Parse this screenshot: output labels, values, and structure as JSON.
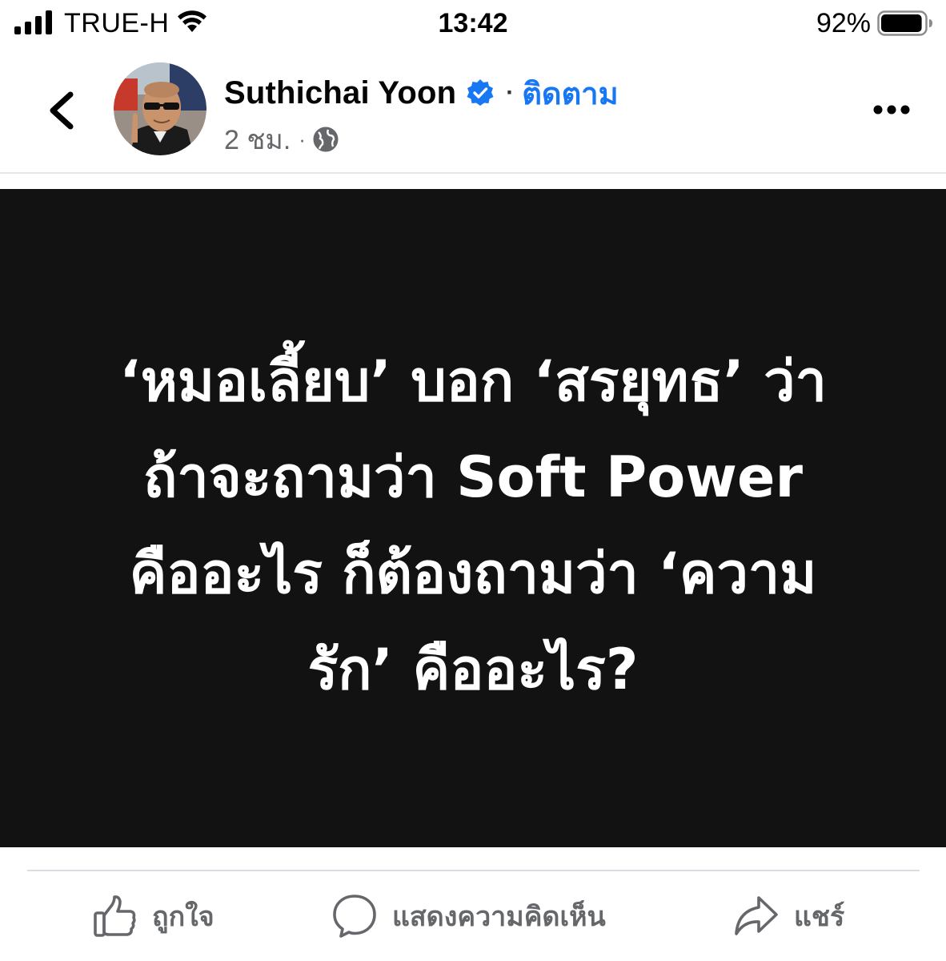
{
  "status_bar": {
    "carrier": "TRUE-H",
    "time": "13:42",
    "battery_percent": "92%",
    "battery_level": 0.92,
    "icons": [
      "signal-bars-icon",
      "wifi-icon",
      "battery-icon"
    ]
  },
  "post": {
    "author": "Suthichai Yoon",
    "verified": true,
    "separator": "·",
    "follow_label": "ติดตาม",
    "timestamp": "2 ชม.",
    "meta_separator": "·",
    "audience_icon": "globe-icon",
    "header_icons": [
      "back-chevron-icon",
      "more-options-icon",
      "verified-badge-icon"
    ]
  },
  "image": {
    "lines": [
      "‘หมอเลี้ยบ’ บอก ‘สรยุทธ’ ว่า",
      "ถ้าจะถามว่า Soft Power",
      "คืออะไร ก็ต้องถามว่า ‘ความ",
      "รัก’ คืออะไร?"
    ],
    "background_color": "#121212",
    "text_color": "#ffffff"
  },
  "actions": {
    "like_label": "ถูกใจ",
    "comment_label": "แสดงความคิดเห็น",
    "share_label": "แชร์",
    "icons": [
      "like-thumb-icon",
      "comment-bubble-icon",
      "share-arrow-icon"
    ]
  },
  "colors": {
    "accent": "#1877f2",
    "secondary_text": "#65676b"
  }
}
